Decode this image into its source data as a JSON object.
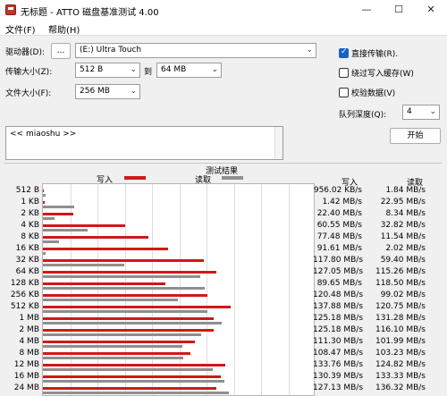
{
  "window": {
    "title": "无标题 - ATTO 磁盘基准测试 4.00",
    "minimize": "—",
    "maximize": "☐",
    "close": "✕"
  },
  "menu": [
    "文件(F)",
    "帮助(H)"
  ],
  "settings": {
    "drive_label": "驱动器(D):",
    "browse_label": "...",
    "drive_value": "(E:) Ultra Touch",
    "transfer_label": "传输大小(Z):",
    "transfer_from": "512 B",
    "to_label": "到",
    "transfer_to": "64 MB",
    "filesize_label": "文件大小(F):",
    "filesize_value": "256 MB"
  },
  "options": {
    "direct_io_label": "直接传输(R).",
    "direct_io_checked": true,
    "bypass_cache_label": "绕过写入缓存(W)",
    "bypass_cache_checked": false,
    "verify_label": "校验数据(V)",
    "verify_checked": false,
    "queue_depth_label": "队列深度(Q):",
    "queue_depth_value": "4",
    "start_label": "开始"
  },
  "description": "<< miaoshu >>",
  "results": {
    "title": "测试结果",
    "write_legend": "写入",
    "read_legend": "读取",
    "write_header": "写入",
    "read_header": "读取",
    "colors": {
      "write": "#d01818",
      "read": "#8f8f8f"
    }
  },
  "chart_data": {
    "type": "bar",
    "title": "测试结果",
    "orientation": "horizontal",
    "categories": [
      "512 B",
      "1 KB",
      "2 KB",
      "4 KB",
      "8 KB",
      "16 KB",
      "32 KB",
      "64 KB",
      "128 KB",
      "256 KB",
      "512 KB",
      "1 MB",
      "2 MB",
      "4 MB",
      "8 MB",
      "12 MB",
      "16 MB",
      "24 MB"
    ],
    "xlim": [
      0,
      200
    ],
    "grid": true,
    "series": [
      {
        "name": "写入",
        "values": [
          956.02,
          1.42,
          22.4,
          60.55,
          77.48,
          91.61,
          117.8,
          127.05,
          89.65,
          120.48,
          137.88,
          125.18,
          125.18,
          111.3,
          108.47,
          133.76,
          130.39,
          127.13
        ],
        "labels": [
          "956.02 KB/s",
          "1.42 MB/s",
          "22.40 MB/s",
          "60.55 MB/s",
          "77.48 MB/s",
          "91.61 MB/s",
          "117.80 MB/s",
          "127.05 MB/s",
          "89.65 MB/s",
          "120.48 MB/s",
          "137.88 MB/s",
          "125.18 MB/s",
          "125.18 MB/s",
          "111.30 MB/s",
          "108.47 MB/s",
          "133.76 MB/s",
          "130.39 MB/s",
          "127.13 MB/s"
        ]
      },
      {
        "name": "读取",
        "values": [
          1.84,
          22.95,
          8.34,
          32.82,
          11.54,
          2.02,
          59.4,
          115.26,
          118.5,
          99.02,
          120.75,
          131.28,
          116.1,
          101.99,
          103.23,
          124.82,
          133.33,
          136.32
        ],
        "labels": [
          "1.84 MB/s",
          "22.95 MB/s",
          "8.34 MB/s",
          "32.82 MB/s",
          "11.54 MB/s",
          "2.02 MB/s",
          "59.40 MB/s",
          "115.26 MB/s",
          "118.50 MB/s",
          "99.02 MB/s",
          "120.75 MB/s",
          "131.28 MB/s",
          "116.10 MB/s",
          "101.99 MB/s",
          "103.23 MB/s",
          "124.82 MB/s",
          "133.33 MB/s",
          "136.32 MB/s"
        ]
      }
    ]
  }
}
